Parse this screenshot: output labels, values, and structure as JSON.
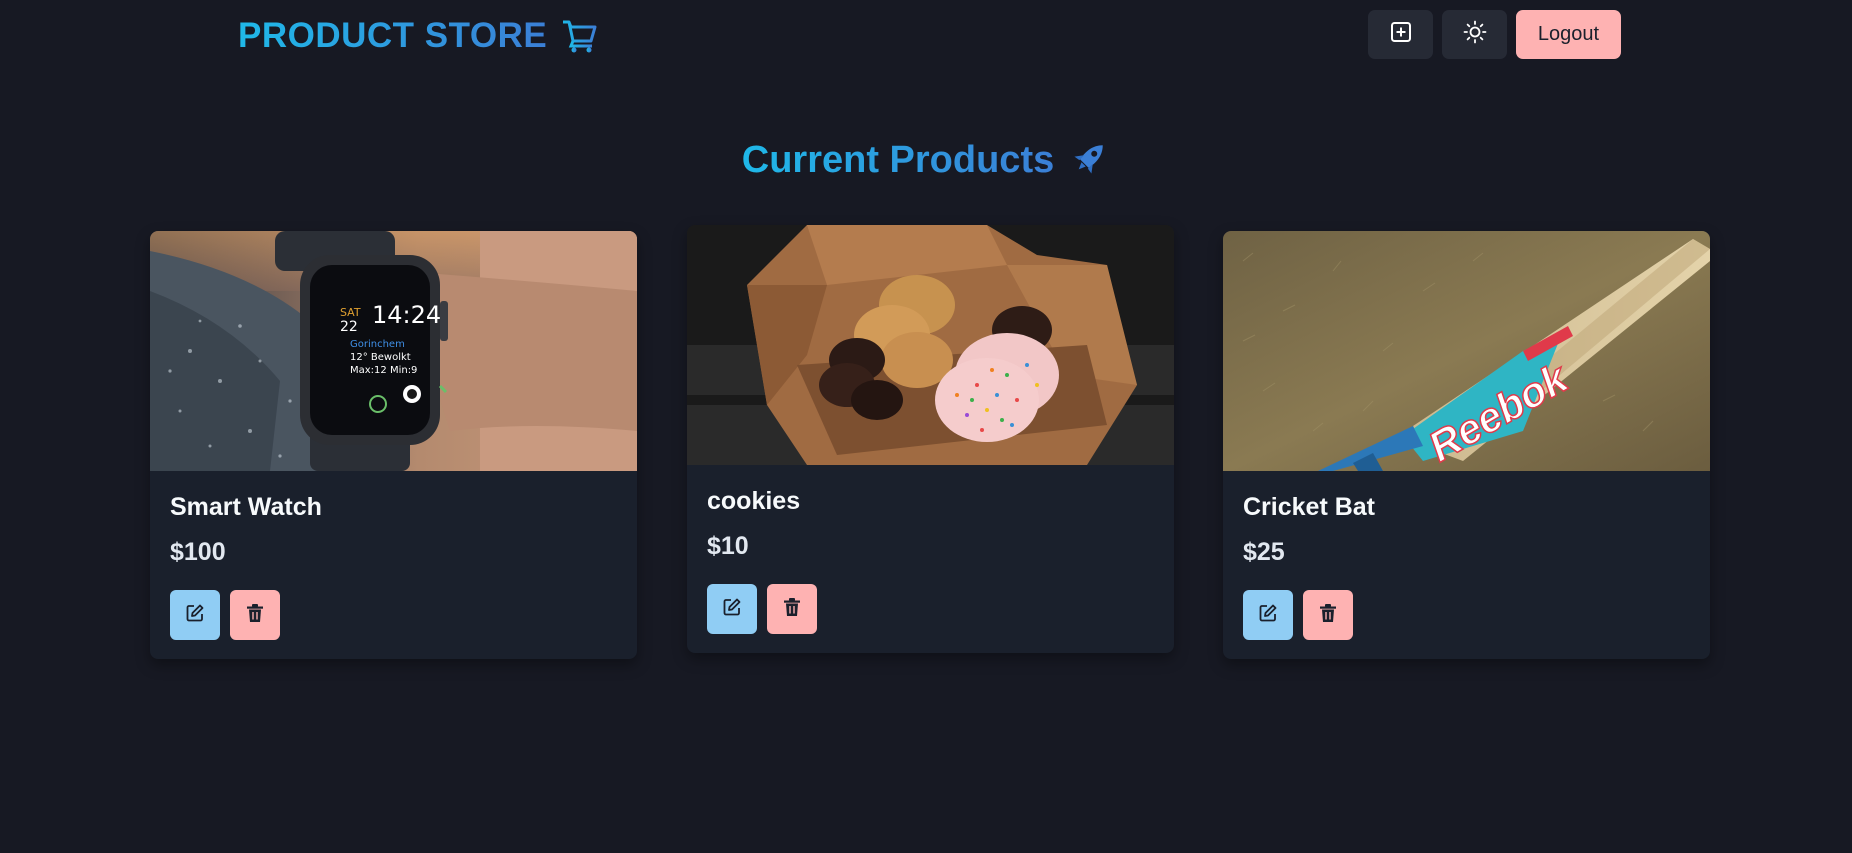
{
  "navbar": {
    "brand": "PRODUCT STORE",
    "brand_icon": "shopping-cart-icon",
    "create_icon": "plus-square-icon",
    "theme_icon": "sun-icon",
    "logout_label": "Logout"
  },
  "heading": {
    "title": "Current Products",
    "icon": "rocket-icon"
  },
  "products": [
    {
      "name": "Smart Watch",
      "price": "$100",
      "image": "smartwatch-image",
      "edit_icon": "edit-icon",
      "delete_icon": "trash-icon"
    },
    {
      "name": "cookies",
      "price": "$10",
      "image": "cookies-box-image",
      "edit_icon": "edit-icon",
      "delete_icon": "trash-icon"
    },
    {
      "name": "Cricket Bat",
      "price": "$25",
      "image": "cricket-bat-image",
      "edit_icon": "edit-icon",
      "delete_icon": "trash-icon"
    }
  ],
  "colors": {
    "background": "#171923",
    "card": "#1a202c",
    "accent_gradient_start": "#1fb8e8",
    "accent_gradient_end": "#3b7fd6",
    "edit_button": "#90cdf4",
    "delete_button": "#feb2b2",
    "logout_button": "#feb2b2"
  }
}
